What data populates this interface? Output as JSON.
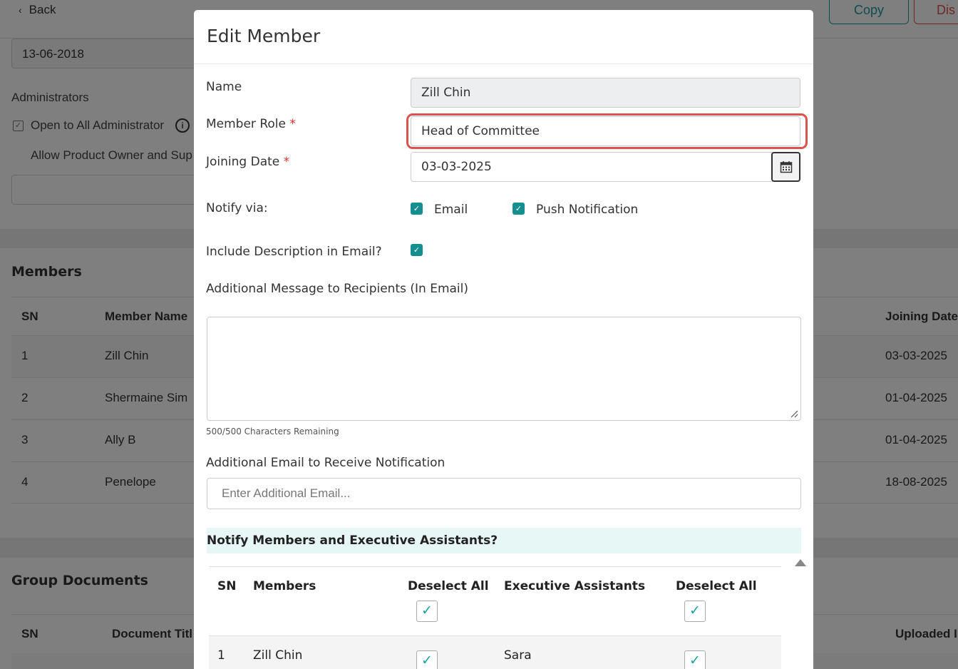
{
  "topbar": {
    "back_label": "Back",
    "copy_label": "Copy",
    "discard_label": "Dis"
  },
  "background": {
    "date_value": "13-06-2018",
    "administrators_label": "Administrators",
    "open_all_label": "Open to All Administrator",
    "allow_text": "Allow Product Owner and Sup",
    "members_title": "Members",
    "members_table": {
      "headers": {
        "sn": "SN",
        "name": "Member Name",
        "joining": "Joining Date"
      },
      "rows": [
        {
          "sn": "1",
          "name": "Zill Chin",
          "joining": "03-03-2025"
        },
        {
          "sn": "2",
          "name": "Shermaine Sim",
          "joining": "01-04-2025"
        },
        {
          "sn": "3",
          "name": "Ally B",
          "joining": "01-04-2025"
        },
        {
          "sn": "4",
          "name": "Penelope",
          "joining": "18-08-2025"
        }
      ]
    },
    "docs_title": "Group Documents",
    "docs_table": {
      "headers": {
        "sn": "SN",
        "title": "Document Titl",
        "uploaded": "Uploaded I"
      }
    }
  },
  "modal": {
    "title": "Edit Member",
    "name_label": "Name",
    "name_value": "Zill Chin",
    "role_label": "Member Role",
    "role_value": "Head of Committee",
    "joining_label": "Joining Date",
    "joining_value": "03-03-2025",
    "required_mark": "*",
    "notify_label": "Notify via:",
    "email_option": "Email",
    "push_option": "Push Notification",
    "include_desc_label": "Include Description in Email?",
    "additional_message_label": "Additional Message to Recipients (In Email)",
    "chars_remaining": "500/500 Characters Remaining",
    "additional_email_label": "Additional Email to Receive Notification",
    "additional_email_placeholder": "Enter Additional Email...",
    "notify_section_title": "Notify Members and Executive Assistants?",
    "notify_table": {
      "headers": {
        "sn": "SN",
        "members": "Members",
        "deselect_members": "Deselect All",
        "assistants": "Executive Assistants",
        "deselect_assistants": "Deselect All"
      },
      "rows": [
        {
          "sn": "1",
          "member": "Zill Chin",
          "assistant": "Sara"
        }
      ]
    }
  },
  "colors": {
    "accent_teal": "#138f8f",
    "required_red": "#d9302c",
    "highlight_red": "#d9534f",
    "notify_bg": "#e6f7f5"
  }
}
